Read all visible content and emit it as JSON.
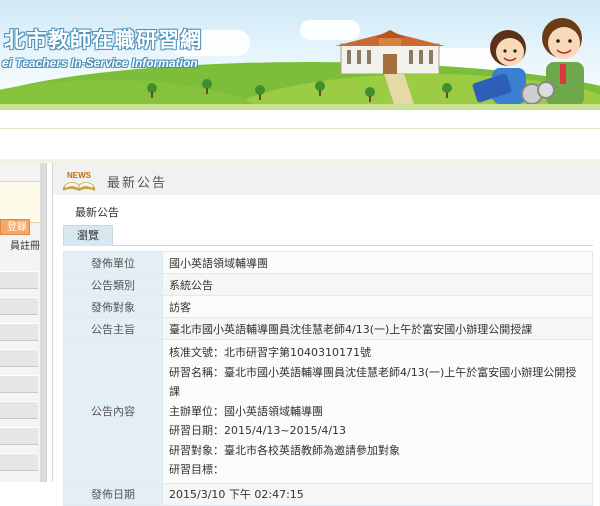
{
  "banner": {
    "title": "北市教師在職研習網",
    "subtitle": "ei Teachers In-Service Information"
  },
  "left": {
    "login_button": "登錄",
    "register_link": "員註冊"
  },
  "panel": {
    "title": "最新公告",
    "breadcrumb": "最新公告",
    "tab": "瀏覽"
  },
  "detail": {
    "rows": [
      {
        "label": "發佈單位",
        "value": "國小英語領域輔導團"
      },
      {
        "label": "公告類別",
        "value": "系統公告"
      },
      {
        "label": "發佈對象",
        "value": "訪客"
      },
      {
        "label": "公告主旨",
        "value": "臺北市國小英語輔導團員沈佳慧老師4/13(一)上午於富安國小辦理公開授課"
      }
    ],
    "content_label": "公告內容",
    "content_lines": [
      "核准文號：北市研習字第1040310171號",
      "研習名稱：臺北市國小英語輔導團員沈佳慧老師4/13(一)上午於富安國小辦理公開授課",
      "主辦單位：國小英語領域輔導團",
      "研習日期：2015/4/13~2015/4/13",
      "研習對象：臺北市各校英語教師為邀請參加對象",
      "研習目標："
    ],
    "date_label": "發佈日期",
    "date_value": "2015/3/10 下午 02:47:15"
  },
  "colors": {
    "label_bg": "#e4eef5",
    "tab_bg": "#d8e8f0",
    "login_button": "#f5a866"
  },
  "icons": [
    "news-book-icon"
  ]
}
